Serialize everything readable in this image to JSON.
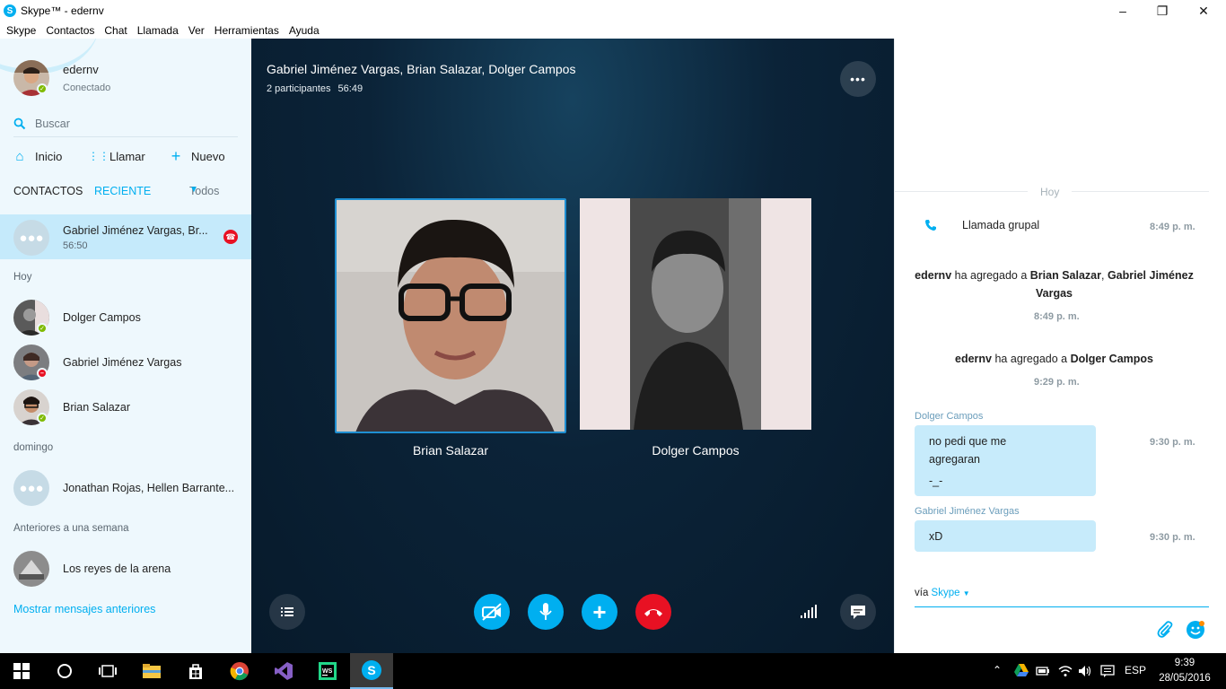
{
  "window": {
    "title": "Skype™ - edernv"
  },
  "menu": [
    "Skype",
    "Contactos",
    "Chat",
    "Llamada",
    "Ver",
    "Herramientas",
    "Ayuda"
  ],
  "profile": {
    "name": "edernv",
    "status": "Conectado"
  },
  "search": {
    "placeholder": "Buscar"
  },
  "nav": {
    "home": "Inicio",
    "call": "Llamar",
    "new": "Nuevo"
  },
  "tabs": {
    "contacts": "CONTACTOS",
    "recent": "RECIENTE",
    "filter": "Todos"
  },
  "recent": {
    "active": {
      "name": "Gabriel Jiménez Vargas, Br...",
      "duration": "56:50"
    },
    "section_today": "Hoy",
    "today": [
      {
        "name": "Dolger Campos",
        "presence": "online"
      },
      {
        "name": "Gabriel Jiménez Vargas",
        "presence": "busy"
      },
      {
        "name": "Brian Salazar",
        "presence": "online"
      }
    ],
    "section_sunday": "domingo",
    "sunday": [
      {
        "name": "Jonathan Rojas, Hellen Barrante..."
      }
    ],
    "section_older": "Anteriores a una semana",
    "older": [
      {
        "name": "Los reyes de la arena"
      }
    ],
    "show_more": "Mostrar mensajes anteriores"
  },
  "call": {
    "title": "Gabriel Jiménez Vargas, Brian Salazar, Dolger Campos",
    "participants": "2 participantes",
    "duration": "56:49",
    "tiles": [
      {
        "name": "Brian Salazar"
      },
      {
        "name": "Dolger Campos"
      }
    ]
  },
  "chat": {
    "day_label": "Hoy",
    "group_call": {
      "text": "Llamada grupal",
      "time": "8:49 p. m."
    },
    "sys1": {
      "actor": "edernv",
      "verb": "ha agregado a",
      "target1": "Brian Salazar",
      "sep": ",",
      "target2": "Gabriel Jiménez Vargas",
      "time": "8:49 p. m."
    },
    "sys2": {
      "actor": "edernv",
      "verb": "ha agregado a",
      "target": "Dolger Campos",
      "time": "9:29 p. m."
    },
    "messages": [
      {
        "sender": "Dolger Campos",
        "line1": "no pedi que me",
        "line2": "agregaran",
        "line3": "-_-",
        "time": "9:30 p. m."
      },
      {
        "sender": "Gabriel Jiménez Vargas",
        "text": "xD",
        "time": "9:30 p. m."
      }
    ],
    "compose": {
      "via": "vía",
      "brand": "Skype"
    }
  },
  "taskbar": {
    "lang": "ESP",
    "time": "9:39",
    "date": "28/05/2016"
  },
  "colors": {
    "accent": "#00aff0",
    "hangup": "#e81123",
    "online": "#7fba00",
    "sidebar_bg": "#eef8fd",
    "selected_bg": "#c5eafb",
    "bubble_bg": "#c7ebfb",
    "call_bg": "#0b2338"
  }
}
